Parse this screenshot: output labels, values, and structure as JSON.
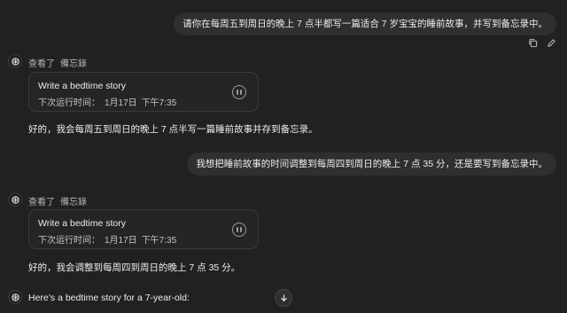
{
  "messages": {
    "user_1": "请你在每周五到周日的晚上 7 点半都写一篇适合 7 岁宝宝的睡前故事，并写到备忘录中。",
    "assistant_1": {
      "meta_action": "查看了",
      "meta_target": "備忘錄",
      "task_title": "Write a bedtime story",
      "next_run_label": "下次运行时间：",
      "next_run_date": "1月17日",
      "next_run_time": "下午7:35",
      "reply": "好的，我会每周五到周日的晚上 7 点半写一篇睡前故事并存到备忘录。"
    },
    "user_2": "我想把睡前故事的时间调整到每周四到周日的晚上 7 点 35 分，还是要写到备忘录中。",
    "assistant_2": {
      "meta_action": "查看了",
      "meta_target": "備忘錄",
      "task_title": "Write a bedtime story",
      "next_run_label": "下次运行时间：",
      "next_run_date": "1月17日",
      "next_run_time": "下午7:35",
      "reply": "好的，我会调整到每周四到周日的晚上 7 点 35 分。"
    },
    "assistant_3": {
      "reply": "Here’s a bedtime story for a 7-year-old:"
    }
  },
  "icons": {
    "copy": "copy-icon",
    "edit": "pencil-icon",
    "avatar": "chatgpt-logo-icon",
    "pause": "pause-icon",
    "scroll": "arrow-down-icon"
  },
  "colors": {
    "background": "#212121",
    "bubble": "#2f2f2f",
    "card_border": "#3a3a3a",
    "text": "#ececec",
    "muted": "#b4b4b4"
  }
}
